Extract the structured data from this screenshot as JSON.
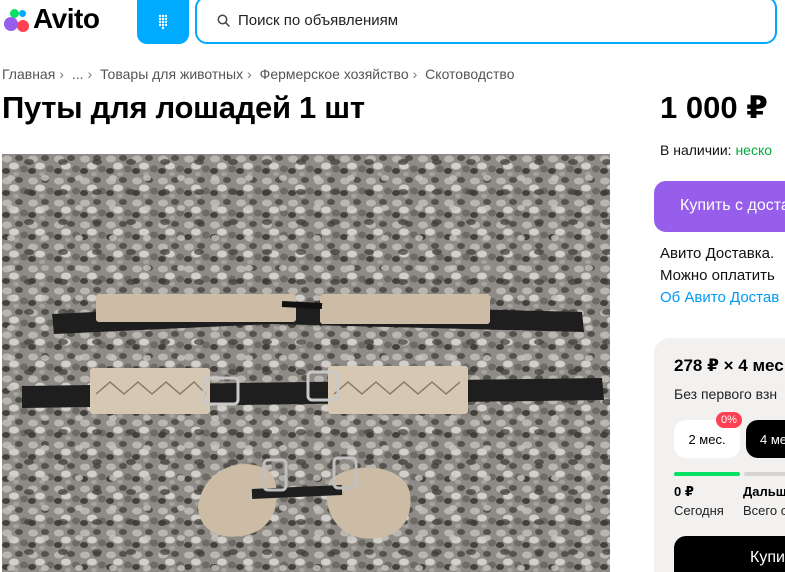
{
  "header": {
    "logo_text": "Avito",
    "search_placeholder": "Поиск по объявлениям"
  },
  "breadcrumbs": [
    "Главная",
    "...",
    "Товары для животных",
    "Фермерское хозяйство",
    "Скотоводство"
  ],
  "listing": {
    "title": "Путы для лошадей 1 шт",
    "price": "1 000 ₽",
    "stock_label": "В наличии:",
    "stock_value": "неско",
    "buy_label": "Купить с доста",
    "delivery_line1": "Авито Доставка.",
    "delivery_line2": "Можно оплатить",
    "delivery_link": "Об Авито Достав"
  },
  "credit": {
    "sum": "278 ₽ × 4 мес",
    "subtitle": "Без первого взн",
    "terms": [
      {
        "label": "2 мес.",
        "badge": "0%"
      },
      {
        "label": "4 ме"
      }
    ],
    "steps": [
      {
        "title": "0 ₽",
        "subtitle": "Сегодня"
      },
      {
        "title": "Дальш",
        "subtitle": "Всего с"
      }
    ],
    "buy_label": "Купит"
  },
  "colors": {
    "accent": "#00aaff",
    "buy_button": "#965eeb",
    "in_stock": "#02a93d",
    "link": "#0099f7",
    "badge": "#ff4053",
    "progress": "#04e061"
  }
}
